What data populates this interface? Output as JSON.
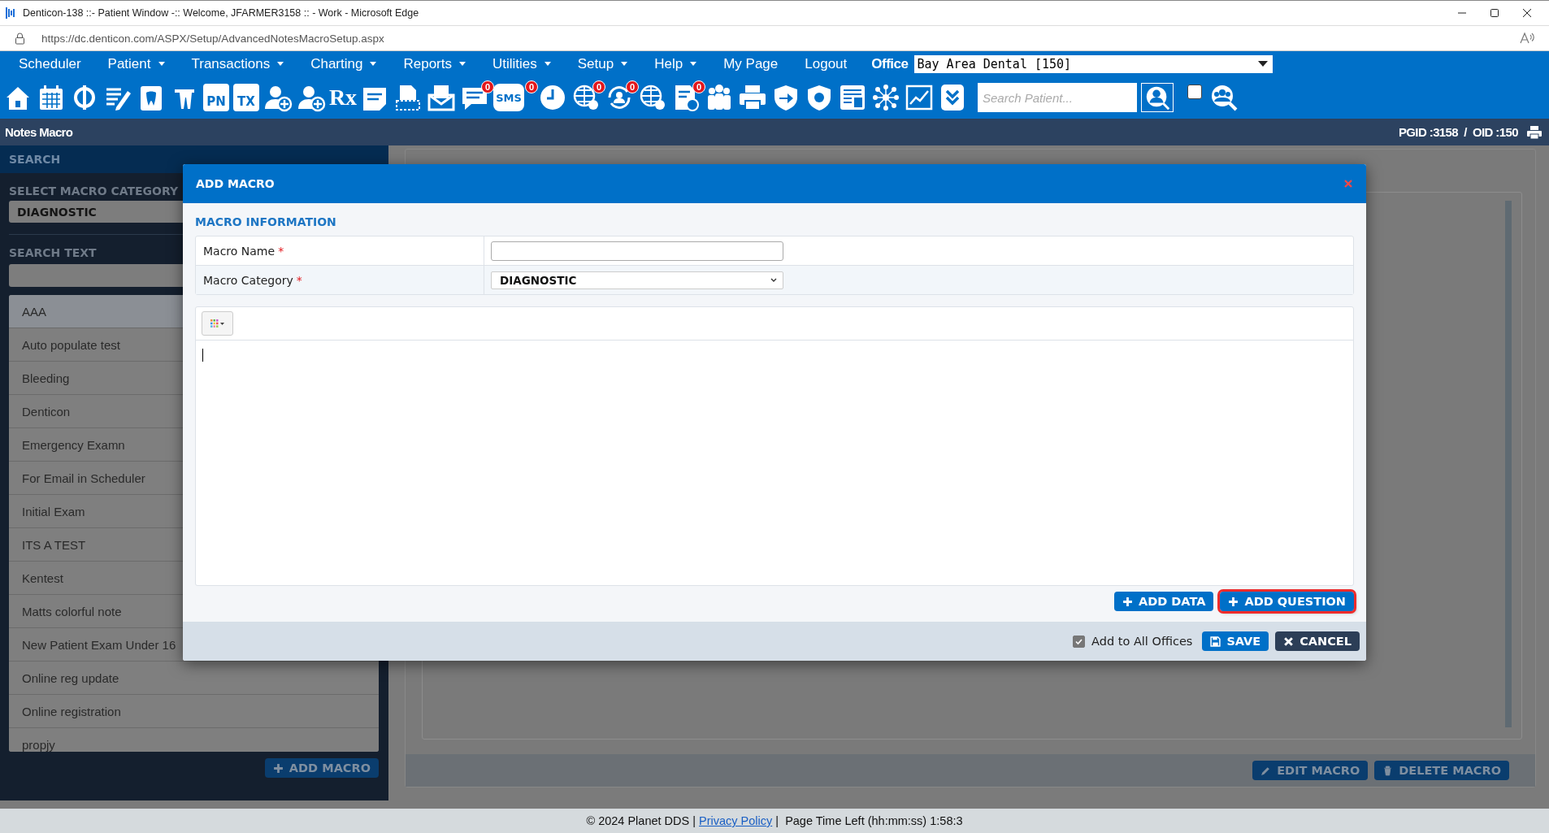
{
  "window": {
    "title": "Denticon-138 ::- Patient Window -:: Welcome, JFARMER3158 :: - Work - Microsoft Edge",
    "url": "https://dc.denticon.com/ASPX/Setup/AdvancedNotesMacroSetup.aspx"
  },
  "menu": [
    {
      "label": "Scheduler",
      "has_dropdown": false
    },
    {
      "label": "Patient",
      "has_dropdown": true
    },
    {
      "label": "Transactions",
      "has_dropdown": true
    },
    {
      "label": "Charting",
      "has_dropdown": true
    },
    {
      "label": "Reports",
      "has_dropdown": true
    },
    {
      "label": "Utilities",
      "has_dropdown": true
    },
    {
      "label": "Setup",
      "has_dropdown": true
    },
    {
      "label": "Help",
      "has_dropdown": true
    },
    {
      "label": "My Page",
      "has_dropdown": false
    },
    {
      "label": "Logout",
      "has_dropdown": false
    }
  ],
  "office": {
    "label": "Office",
    "value": "Bay Area Dental [150]"
  },
  "toolbar": {
    "labels": [
      "PN",
      "TX",
      "Rx",
      "SMS"
    ],
    "badges": [
      "0",
      "0",
      "0",
      "0",
      "0"
    ],
    "search": {
      "placeholder": "Search Patient..."
    },
    "checkbox": {
      "checked": false
    }
  },
  "page_header": {
    "title": "Notes Macro",
    "ids": "PGID :3158  /  OID :150"
  },
  "sidebar": {
    "heading": "SEARCH",
    "category_label": "SELECT MACRO CATEGORY",
    "category_value": "DIAGNOSTIC",
    "search_label": "SEARCH TEXT",
    "items": [
      {
        "label": "AAA",
        "selected": true
      },
      {
        "label": "Auto populate test",
        "selected": false
      },
      {
        "label": "Bleeding",
        "selected": false
      },
      {
        "label": "Denticon",
        "selected": false
      },
      {
        "label": "Emergency Examn",
        "selected": false
      },
      {
        "label": "For Email in Scheduler",
        "selected": false
      },
      {
        "label": "Initial Exam",
        "selected": false
      },
      {
        "label": "ITS A TEST",
        "selected": false
      },
      {
        "label": "Kentest",
        "selected": false
      },
      {
        "label": "Matts colorful note",
        "selected": false
      },
      {
        "label": "New Patient Exam Under 16",
        "selected": false
      },
      {
        "label": "Online reg update",
        "selected": false
      },
      {
        "label": "Online registration",
        "selected": false
      },
      {
        "label": "propjy",
        "selected": false
      }
    ],
    "add_button": "ADD MACRO"
  },
  "detail": {
    "buttons": [
      {
        "label": "EDIT MACRO",
        "kind": "edit"
      },
      {
        "label": "DELETE MACRO",
        "kind": "delete"
      }
    ]
  },
  "dialog": {
    "title": "ADD MACRO",
    "section": "MACRO INFORMATION",
    "fields": [
      {
        "label": "Macro Name",
        "required_mark": "*",
        "kind": "text"
      },
      {
        "label": "Macro Category",
        "required_mark": "*",
        "kind": "select",
        "value": "DIAGNOSTIC"
      }
    ],
    "actions": [
      {
        "label": "ADD DATA",
        "highlighted": false
      },
      {
        "label": "ADD QUESTION",
        "highlighted": true
      }
    ],
    "add_all_offices": {
      "label": "Add to All Offices",
      "checked": true
    },
    "buttons": [
      {
        "label": "SAVE",
        "kind": "save"
      },
      {
        "label": "CANCEL",
        "kind": "cancel"
      }
    ]
  },
  "footer": {
    "copyright": "© 2024 Planet DDS |",
    "link": "Privacy Policy",
    "time_left": "|  Page Time Left (hh:mm:ss) 1:58:3"
  }
}
